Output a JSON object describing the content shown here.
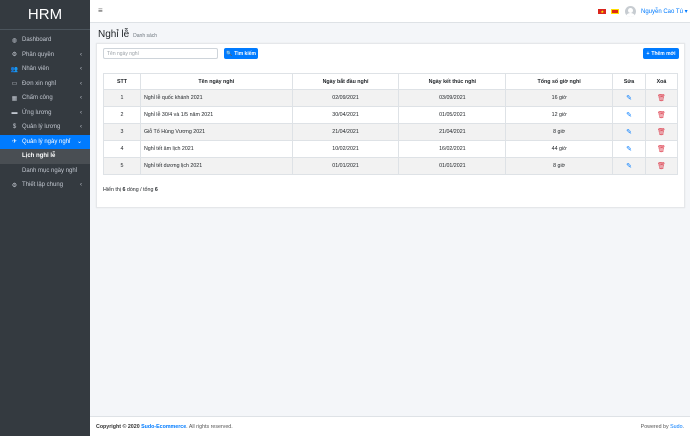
{
  "app": {
    "logo": "HRM"
  },
  "sidebar": {
    "items": [
      {
        "label": "Dashboard",
        "icon": "◍",
        "chev": ""
      },
      {
        "label": "Phân quyền",
        "icon": "⚙",
        "chev": "‹"
      },
      {
        "label": "Nhân viên",
        "icon": "👥",
        "chev": "‹"
      },
      {
        "label": "Đơn xin nghỉ",
        "icon": "▭",
        "chev": "‹"
      },
      {
        "label": "Chấm công",
        "icon": "▦",
        "chev": "‹"
      },
      {
        "label": "Ứng lương",
        "icon": "▬",
        "chev": "‹"
      },
      {
        "label": "Quản lý lương",
        "icon": "$",
        "chev": "‹"
      },
      {
        "label": "Quản lý ngày nghỉ",
        "icon": "✈",
        "chev": "⌄"
      }
    ],
    "subitems": [
      {
        "label": "Lịch nghỉ lễ"
      },
      {
        "label": "Danh mục ngày nghỉ"
      }
    ],
    "settings": {
      "label": "Thiết lập chung",
      "icon": "⚙",
      "chev": "‹"
    }
  },
  "topbar": {
    "menu_icon": "≡",
    "user_name": "Nguyễn Cao Tú",
    "vn_star": "★",
    "user_chevron": "▾"
  },
  "header": {
    "title": "Nghỉ lễ",
    "subtitle": "Danh sách"
  },
  "search": {
    "placeholder": "Tên ngày nghỉ",
    "value": ""
  },
  "buttons": {
    "search_label": "Tìm kiếm",
    "search_icon": "🔍",
    "add_label": "Thêm mới",
    "add_icon": "+"
  },
  "table": {
    "headers": [
      "STT",
      "Tên ngày nghỉ",
      "Ngày bắt đầu nghỉ",
      "Ngày kết thúc nghỉ",
      "Tổng số giờ nghỉ",
      "Sửa",
      "Xoá"
    ],
    "edit_icon": "✎",
    "delete_icon": "🗑",
    "rows": [
      {
        "stt": "1",
        "name": "Nghỉ lễ quốc khánh 2021",
        "start": "02/09/2021",
        "end": "03/09/2021",
        "hours": "16 giờ"
      },
      {
        "stt": "2",
        "name": "Nghỉ lễ 30/4 và 1/5 năm 2021",
        "start": "30/04/2021",
        "end": "01/05/2021",
        "hours": "12 giờ"
      },
      {
        "stt": "3",
        "name": "Giỗ Tổ Hùng Vương 2021",
        "start": "21/04/2021",
        "end": "21/04/2021",
        "hours": "8 giờ"
      },
      {
        "stt": "4",
        "name": "Nghỉ tết âm lịch 2021",
        "start": "10/02/2021",
        "end": "16/02/2021",
        "hours": "44 giờ"
      },
      {
        "stt": "5",
        "name": "Nghỉ tết dương lịch 2021",
        "start": "01/01/2021",
        "end": "01/01/2021",
        "hours": "8 giờ"
      }
    ]
  },
  "summary": {
    "prefix": "Hiển thị",
    "shown": "6",
    "middle": "dòng / tổng",
    "total": "6"
  },
  "footer": {
    "copyright_prefix": "Copyright © 2020",
    "brand": "Sudo-Ecommerce",
    "rights": ". All rights reserved.",
    "powered_prefix": "Powered by",
    "powered_link": "Sudo",
    "powered_suffix": "."
  }
}
